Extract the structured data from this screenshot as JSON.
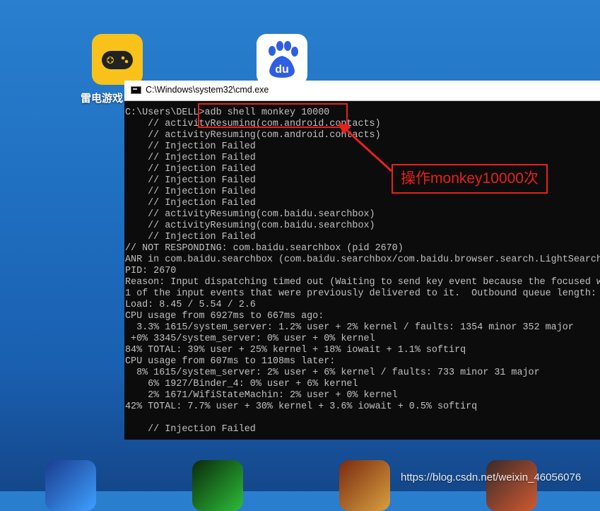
{
  "desktop": {
    "icons": [
      {
        "name": "雷电游戏中心",
        "label": "雷电游戏",
        "color": "#f8c21a"
      },
      {
        "name": "百度",
        "label": "",
        "color": "#ffffff"
      },
      {
        "name": "game-app-1",
        "label": ""
      },
      {
        "name": "game-app-2",
        "label": ""
      },
      {
        "name": "game-app-3",
        "label": ""
      },
      {
        "name": "game-app-4",
        "label": ""
      }
    ]
  },
  "window": {
    "title": "C:\\Windows\\system32\\cmd.exe"
  },
  "console": {
    "lines": [
      "C:\\Users\\DELL>adb shell monkey 10000",
      "    // activityResuming(com.android.contacts)",
      "    // activityResuming(com.android.contacts)",
      "    // Injection Failed",
      "    // Injection Failed",
      "    // Injection Failed",
      "    // Injection Failed",
      "    // Injection Failed",
      "    // Injection Failed",
      "    // activityResuming(com.baidu.searchbox)",
      "    // activityResuming(com.baidu.searchbox)",
      "    // Injection Failed",
      "// NOT RESPONDING: com.baidu.searchbox (pid 2670)",
      "ANR in com.baidu.searchbox (com.baidu.searchbox/com.baidu.browser.search.LightSearch",
      "PID: 2670",
      "Reason: Input dispatching timed out (Waiting to send key event because the focused w",
      "1 of the input events that were previously delivered to it.  Outbound queue length:",
      "Load: 8.45 / 5.54 / 2.6",
      "CPU usage from 6927ms to 667ms ago:",
      "  3.3% 1615/system_server: 1.2% user + 2% kernel / faults: 1354 minor 352 major",
      " +0% 3345/system_server: 0% user + 0% kernel",
      "84% TOTAL: 39% user + 25% kernel + 18% iowait + 1.1% softirq",
      "CPU usage from 607ms to 1108ms later:",
      "  8% 1615/system_server: 2% user + 6% kernel / faults: 733 minor 31 major",
      "    6% 1927/Binder_4: 0% user + 6% kernel",
      "    2% 1671/WifiStateMachin: 2% user + 0% kernel",
      "42% TOTAL: 7.7% user + 30% kernel + 3.6% iowait + 0.5% softirq",
      "",
      "    // Injection Failed"
    ]
  },
  "annotation": {
    "callout_text": "操作monkey10000次",
    "color": "#e8201c"
  },
  "watermark": "https://blog.csdn.net/weixin_46056076"
}
